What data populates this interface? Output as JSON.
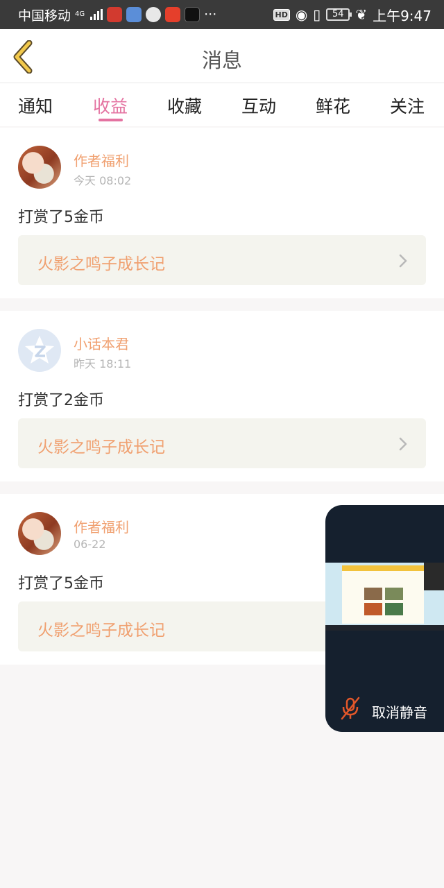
{
  "status_bar": {
    "carrier": "中国移动",
    "network": "4G",
    "battery": "54",
    "time": "上午9:47",
    "more": "···"
  },
  "header": {
    "title": "消息"
  },
  "tabs": [
    {
      "label": "通知",
      "active": false
    },
    {
      "label": "收益",
      "active": true
    },
    {
      "label": "收藏",
      "active": false
    },
    {
      "label": "互动",
      "active": false
    },
    {
      "label": "鲜花",
      "active": false
    },
    {
      "label": "关注",
      "active": false
    }
  ],
  "messages": [
    {
      "user": "作者福利",
      "time": "今天 08:02",
      "text": "打赏了5金币",
      "work": "火影之鸣子成长记"
    },
    {
      "user": "小话本君",
      "time": "昨天 18:11",
      "text": "打赏了2金币",
      "work": "火影之鸣子成长记"
    },
    {
      "user": "作者福利",
      "time": "06-22",
      "text": "打赏了5金币",
      "work": "火影之鸣子成长记"
    }
  ],
  "floating_window": {
    "unmute_label": "取消静音"
  },
  "colors": {
    "accent_pink": "#e473a1",
    "accent_orange": "#f0a070",
    "status_bar": "#3a3a3a",
    "float_bg": "#15202e"
  },
  "icons": [
    "back-arrow-icon",
    "chevron-right-icon",
    "mic-muted-icon",
    "qzone-icon"
  ]
}
